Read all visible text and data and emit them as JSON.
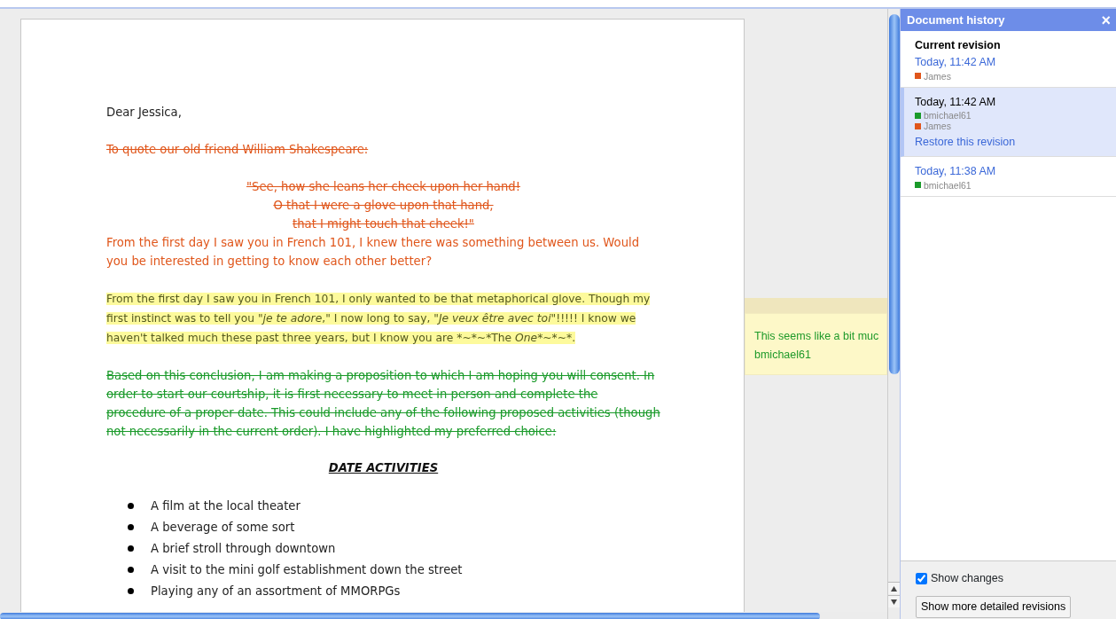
{
  "document": {
    "paragraphs": [
      {
        "kind": "plain",
        "text": "Dear Jessica,"
      },
      {
        "kind": "deleted",
        "color": "#e0561b",
        "text": "To quote our old friend William Shakespeare:"
      },
      {
        "kind": "deleted_center",
        "color": "#e0561b",
        "text": "\"See, how she leans her cheek upon her hand!"
      },
      {
        "kind": "deleted_center",
        "color": "#e0561b",
        "text": "O that I were a glove upon that hand,"
      },
      {
        "kind": "deleted_center",
        "color": "#e0561b",
        "text": "that I might touch that cheek!\""
      },
      {
        "kind": "inserted",
        "color": "#e0561b",
        "text": "From the first day I saw you in French 101, I knew there was something between us. Would you be interested in getting to know each other better?"
      },
      {
        "kind": "highlight",
        "segments": [
          {
            "text": "From the first day I saw you in French 101, I only wanted to be that metaphorical glove. Though my first instinct was to tell you ",
            "italic": false
          },
          {
            "text": "\"je te adore",
            "italic": true
          },
          {
            "text": ",\" I now long to say, \"",
            "italic": false
          },
          {
            "text": "Je veux être avec toi",
            "italic": true
          },
          {
            "text": "\"!!!!! I know we haven't talked much these past three years, but I know you are *~*~*The ",
            "italic": false
          },
          {
            "text": "One",
            "italic": true
          },
          {
            "text": "*~*~*.",
            "italic": false
          }
        ]
      },
      {
        "kind": "deleted",
        "color": "#1a9a2a",
        "text": "Based on this conclusion, I am making a proposition to which I am hoping you will consent. In order to start our courtship, it is first necessary to meet in person and complete the procedure of a proper date.  This could include any of the following proposed activities (though not necessarily in the current order). I have highlighted my preferred choice:"
      },
      {
        "kind": "heading",
        "text": "DATE ACTIVITIES"
      },
      {
        "kind": "bullet",
        "text": "A film at the local theater"
      },
      {
        "kind": "bullet",
        "text": "A beverage of some sort"
      },
      {
        "kind": "bullet",
        "text": "A brief stroll through downtown"
      },
      {
        "kind": "bullet",
        "text": "A visit to the mini golf establishment down the street"
      },
      {
        "kind": "bullet",
        "text": "Playing any of an assortment of MMORPGs"
      }
    ]
  },
  "comment": {
    "text": "This seems like a bit muc",
    "author": "bmichael61"
  },
  "history": {
    "title": "Document history",
    "close": "×",
    "revisions": [
      {
        "heading": "Current revision",
        "time": "Today, 11:42 AM",
        "selected": false,
        "authors": [
          {
            "name": "James",
            "color": "#e0561b"
          }
        ]
      },
      {
        "time": "Today, 11:42 AM",
        "selected": true,
        "authors": [
          {
            "name": "bmichael61",
            "color": "#1a9a2a"
          },
          {
            "name": "James",
            "color": "#e0561b"
          }
        ],
        "restore": "Restore this revision"
      },
      {
        "time": "Today, 11:38 AM",
        "selected": false,
        "authors": [
          {
            "name": "bmichael61",
            "color": "#1a9a2a"
          }
        ]
      }
    ],
    "show_changes": {
      "label": "Show changes",
      "checked": true
    },
    "button": "Show more detailed revisions"
  }
}
